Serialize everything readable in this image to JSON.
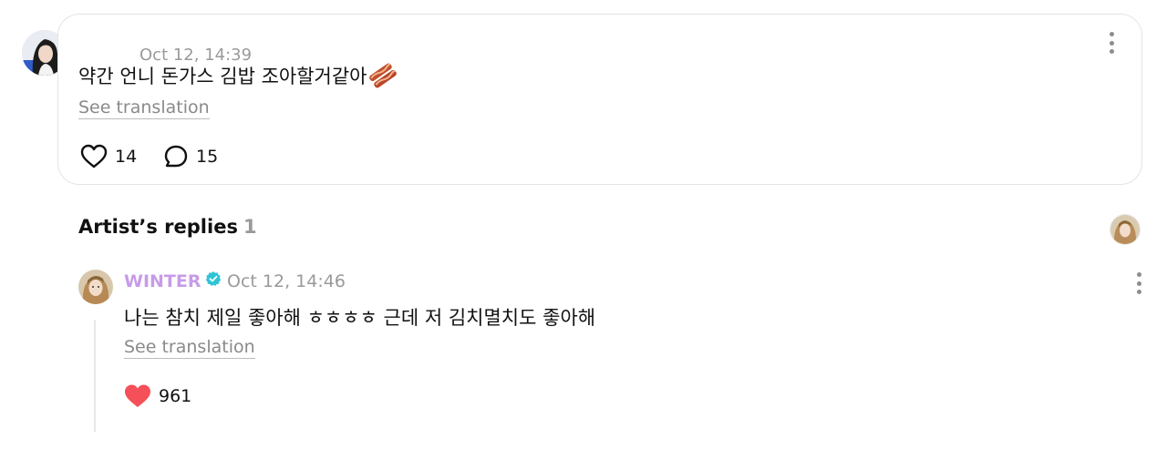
{
  "comment": {
    "time": "Oct 12, 14:39",
    "text": "약간 언니 돈가스 김밥 조아할거같아",
    "emoji": "bacon-emoji",
    "translation_label": "See translation",
    "likes": "14",
    "replies": "15"
  },
  "artist_replies": {
    "title": "Artist’s replies",
    "count": "1",
    "reply": {
      "author": "WINTER",
      "time": "Oct 12, 14:46",
      "text": "나는 참치 제일 좋아해 ㅎㅎㅎㅎ 근데 저 김치멸치도 좋아해",
      "translation_label": "See translation",
      "likes": "961"
    }
  },
  "colors": {
    "artist_name": "#c79be8",
    "verified": "#2ec4d6",
    "heart_filled": "#f5505a",
    "muted_text": "#9a9a9a",
    "card_border": "#e4e4e4"
  }
}
